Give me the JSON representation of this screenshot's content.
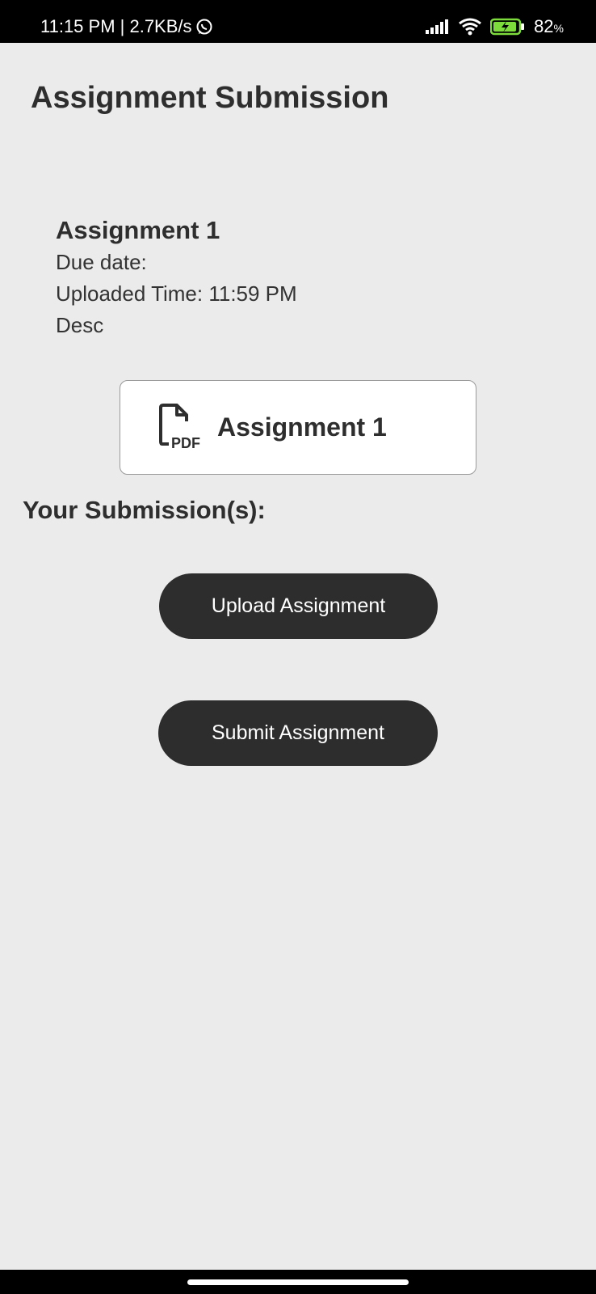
{
  "status_bar": {
    "time_speed": "11:15 PM | 2.7KB/s",
    "battery": "82",
    "battery_unit": "%"
  },
  "header": {
    "title": "Assignment Submission"
  },
  "assignment": {
    "name": "Assignment 1",
    "due_date": "Due date:",
    "uploaded_time": "Uploaded Time: 11:59 PM",
    "description": "Desc"
  },
  "attachment": {
    "icon": "pdf-file-icon",
    "icon_text": "PDF",
    "name": "Assignment 1"
  },
  "submission": {
    "heading": "Your Submission(s):",
    "upload_label": "Upload Assignment",
    "submit_label": "Submit Assignment"
  },
  "colors": {
    "background": "#ebebeb",
    "button": "#2d2d2d",
    "text": "#2e2e2e"
  }
}
